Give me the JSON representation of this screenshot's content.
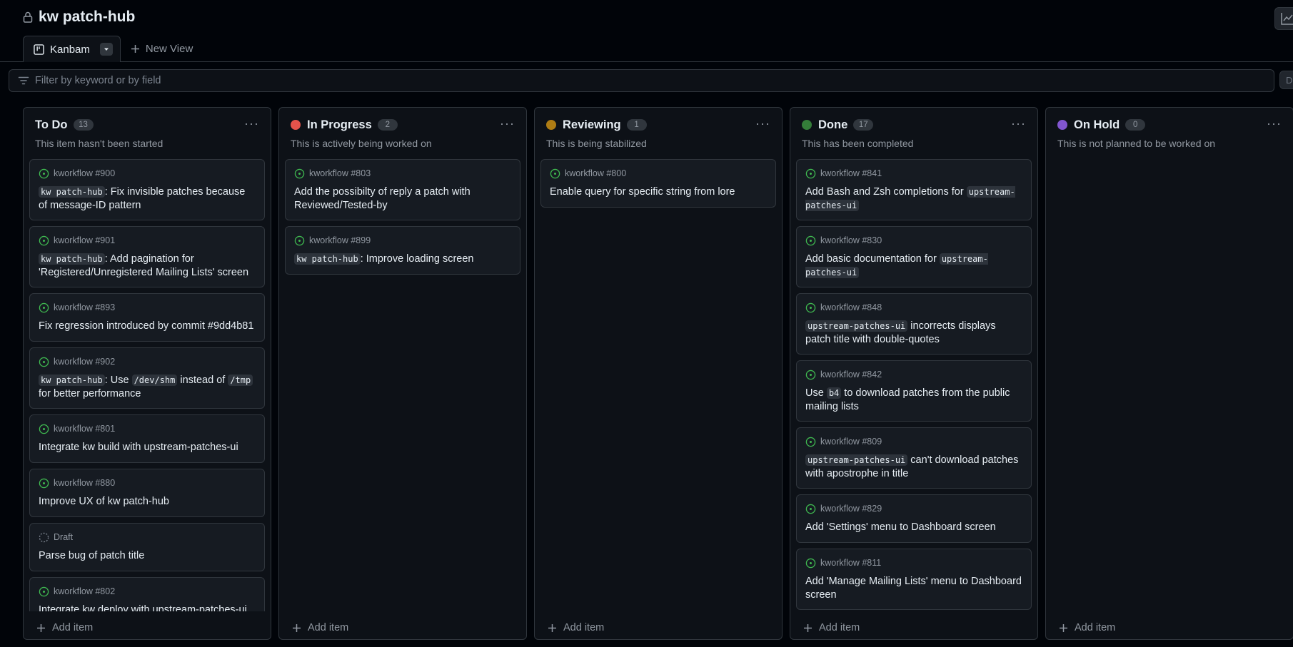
{
  "project": {
    "title": "kw patch-hub"
  },
  "tabs": {
    "active_label": "Kanbam",
    "new_view_label": "New View"
  },
  "filter": {
    "placeholder": "Filter by keyword or by field",
    "discard_label": "Di"
  },
  "add_item_label": "Add item",
  "colors": {
    "todo": "",
    "in_progress": "#e5534b",
    "reviewing": "#ae7c14",
    "done": "#347d39",
    "on_hold": "#8256d0",
    "open_issue": "#3fb950",
    "draft": "#7d8590"
  },
  "columns": [
    {
      "key": "todo",
      "name": "To Do",
      "count": "13",
      "description": "This item hasn't been started",
      "cards": [
        {
          "meta": "kworkflow #900",
          "status": "open",
          "title_parts": [
            {
              "code": "kw patch-hub"
            },
            {
              "text": ": Fix invisible patches because of message-ID pattern"
            }
          ]
        },
        {
          "meta": "kworkflow #901",
          "status": "open",
          "title_parts": [
            {
              "code": "kw patch-hub"
            },
            {
              "text": ": Add pagination for 'Registered/Unregistered Mailing Lists' screen"
            }
          ]
        },
        {
          "meta": "kworkflow #893",
          "status": "open",
          "title_parts": [
            {
              "text": "Fix regression introduced by commit #9dd4b81"
            }
          ]
        },
        {
          "meta": "kworkflow #902",
          "status": "open",
          "title_parts": [
            {
              "code": "kw patch-hub"
            },
            {
              "text": ": Use "
            },
            {
              "code": "/dev/shm"
            },
            {
              "text": " instead of "
            },
            {
              "code": "/tmp"
            },
            {
              "text": " for better performance"
            }
          ]
        },
        {
          "meta": "kworkflow #801",
          "status": "open",
          "title_parts": [
            {
              "text": "Integrate kw build with upstream-patches-ui"
            }
          ]
        },
        {
          "meta": "kworkflow #880",
          "status": "open",
          "title_parts": [
            {
              "text": "Improve UX of kw patch-hub"
            }
          ]
        },
        {
          "meta": "Draft",
          "status": "draft",
          "title_parts": [
            {
              "text": "Parse bug of patch title"
            }
          ]
        },
        {
          "meta": "kworkflow #802",
          "status": "open",
          "title_parts": [
            {
              "text": "Integrate kw deploy with upstream-patches-ui"
            }
          ]
        }
      ]
    },
    {
      "key": "in_progress",
      "name": "In Progress",
      "count": "2",
      "description": "This is actively being worked on",
      "cards": [
        {
          "meta": "kworkflow #803",
          "status": "open",
          "title_parts": [
            {
              "text": "Add the possibilty of reply a patch with Reviewed/Tested-by"
            }
          ]
        },
        {
          "meta": "kworkflow #899",
          "status": "open",
          "title_parts": [
            {
              "code": "kw patch-hub"
            },
            {
              "text": ": Improve loading screen"
            }
          ]
        }
      ]
    },
    {
      "key": "reviewing",
      "name": "Reviewing",
      "count": "1",
      "description": "This is being stabilized",
      "cards": [
        {
          "meta": "kworkflow #800",
          "status": "open",
          "title_parts": [
            {
              "text": "Enable query for specific string from lore"
            }
          ]
        }
      ]
    },
    {
      "key": "done",
      "name": "Done",
      "count": "17",
      "description": "This has been completed",
      "cards": [
        {
          "meta": "kworkflow #841",
          "status": "open",
          "title_parts": [
            {
              "text": "Add Bash and Zsh completions for "
            },
            {
              "code": "upstream-patches-ui"
            }
          ]
        },
        {
          "meta": "kworkflow #830",
          "status": "open",
          "title_parts": [
            {
              "text": "Add basic documentation for "
            },
            {
              "code": "upstream-patches-ui"
            }
          ]
        },
        {
          "meta": "kworkflow #848",
          "status": "open",
          "title_parts": [
            {
              "code": "upstream-patches-ui"
            },
            {
              "text": " incorrects displays patch title with double-quotes"
            }
          ]
        },
        {
          "meta": "kworkflow #842",
          "status": "open",
          "title_parts": [
            {
              "text": "Use "
            },
            {
              "code": "b4"
            },
            {
              "text": " to download patches from the public mailing lists"
            }
          ]
        },
        {
          "meta": "kworkflow #809",
          "status": "open",
          "title_parts": [
            {
              "code": "upstream-patches-ui"
            },
            {
              "text": " can't download patches with apostrophe in title"
            }
          ]
        },
        {
          "meta": "kworkflow #829",
          "status": "open",
          "title_parts": [
            {
              "text": "Add 'Settings' menu to Dashboard screen"
            }
          ]
        },
        {
          "meta": "kworkflow #811",
          "status": "open",
          "title_parts": [
            {
              "text": "Add 'Manage Mailing Lists' menu to Dashboard screen"
            }
          ]
        }
      ]
    },
    {
      "key": "on_hold",
      "name": "On Hold",
      "count": "0",
      "description": "This is not planned to be worked on",
      "cards": []
    }
  ]
}
